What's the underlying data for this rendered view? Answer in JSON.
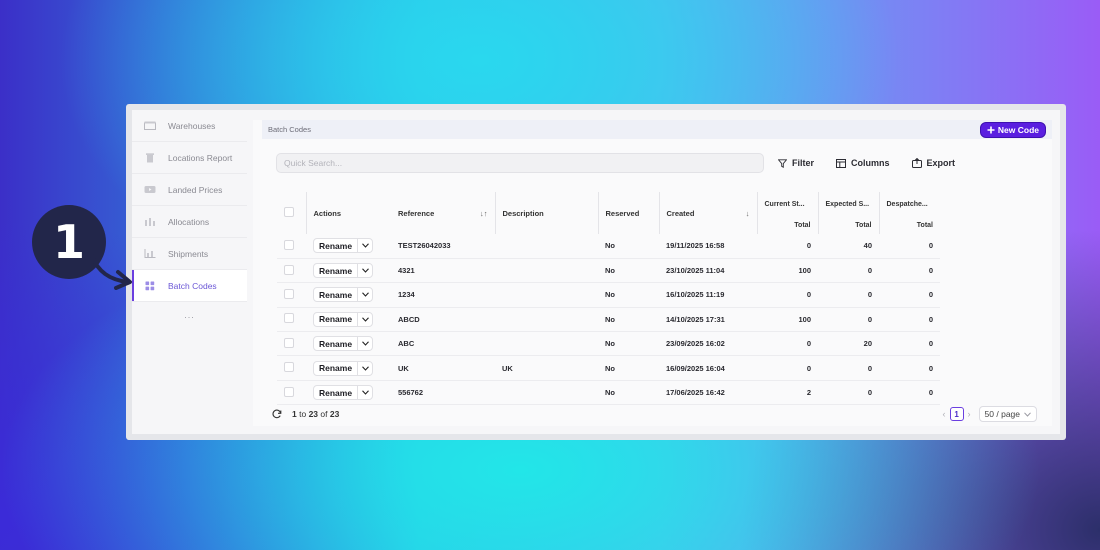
{
  "sidebar": {
    "items": [
      {
        "label": "Warehouses",
        "icon": "warehouse-icon",
        "active": false
      },
      {
        "label": "Locations Report",
        "icon": "trash-icon",
        "active": false
      },
      {
        "label": "Landed Prices",
        "icon": "video-icon",
        "active": false
      },
      {
        "label": "Allocations",
        "icon": "allocations-icon",
        "active": false
      },
      {
        "label": "Shipments",
        "icon": "chart-icon",
        "active": false
      },
      {
        "label": "Batch Codes",
        "icon": "grid-icon",
        "active": true
      }
    ],
    "more": "..."
  },
  "header": {
    "title": "Batch Codes",
    "new_code_label": "New Code"
  },
  "toolbar": {
    "search_placeholder": "Quick Search...",
    "filter_label": "Filter",
    "columns_label": "Columns",
    "export_label": "Export"
  },
  "table": {
    "headers": {
      "actions": "Actions",
      "reference": "Reference",
      "description": "Description",
      "reserved": "Reserved",
      "created": "Created",
      "current_stock": "Current St...",
      "expected_stock": "Expected S...",
      "despatched": "Despatche...",
      "total": "Total"
    },
    "rename_label": "Rename",
    "rows": [
      {
        "reference": "TEST26042033",
        "description": "",
        "reserved": "No",
        "created": "19/11/2025 16:58",
        "current": "0",
        "expected": "40",
        "despatched": "0"
      },
      {
        "reference": "4321",
        "description": "",
        "reserved": "No",
        "created": "23/10/2025 11:04",
        "current": "100",
        "expected": "0",
        "despatched": "0"
      },
      {
        "reference": "1234",
        "description": "",
        "reserved": "No",
        "created": "16/10/2025 11:19",
        "current": "0",
        "expected": "0",
        "despatched": "0"
      },
      {
        "reference": "ABCD",
        "description": "",
        "reserved": "No",
        "created": "14/10/2025 17:31",
        "current": "100",
        "expected": "0",
        "despatched": "0"
      },
      {
        "reference": "ABC",
        "description": "",
        "reserved": "No",
        "created": "23/09/2025 16:02",
        "current": "0",
        "expected": "20",
        "despatched": "0"
      },
      {
        "reference": "UK",
        "description": "UK",
        "reserved": "No",
        "created": "16/09/2025 16:04",
        "current": "0",
        "expected": "0",
        "despatched": "0"
      },
      {
        "reference": "556762",
        "description": "",
        "reserved": "No",
        "created": "17/06/2025 16:42",
        "current": "2",
        "expected": "0",
        "despatched": "0"
      }
    ]
  },
  "footer": {
    "range_start": "1",
    "to": "to",
    "range_end": "23",
    "of": "of",
    "total": "23",
    "current_page": "1",
    "page_size": "50 / page"
  },
  "annotation": {
    "step_number": "1"
  },
  "colors": {
    "accent": "#5a1ee0",
    "active_text": "#6b57d6",
    "badge_bg": "#22264a"
  }
}
